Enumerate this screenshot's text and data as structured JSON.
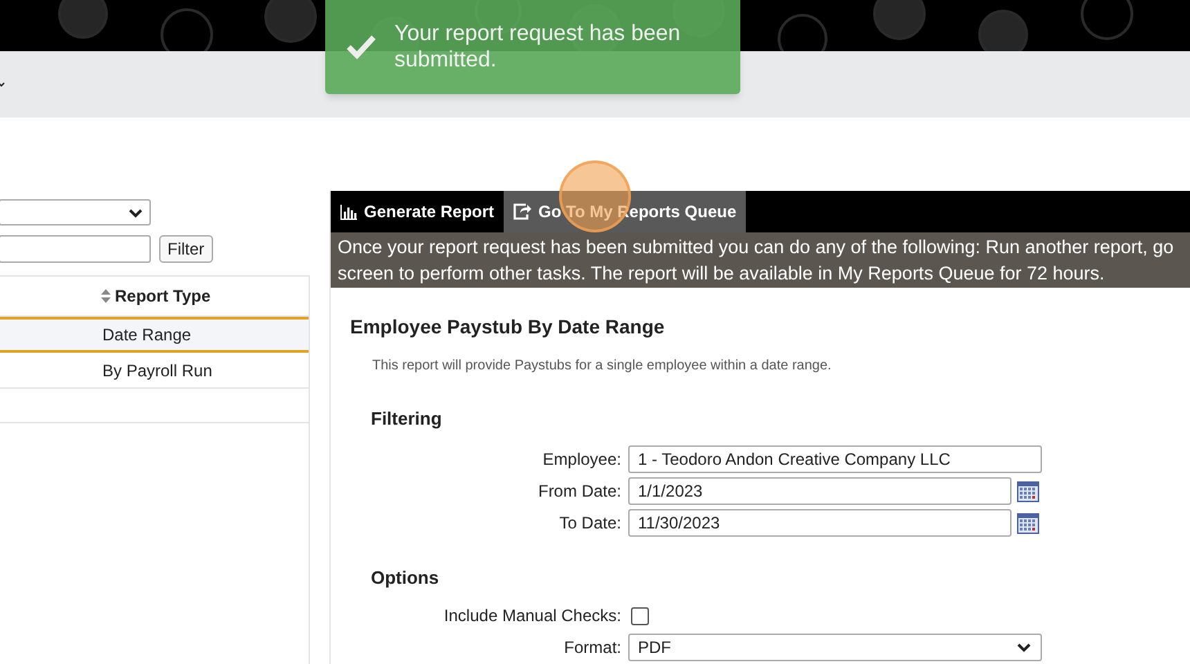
{
  "toast": {
    "message": "Your report request has been submitted."
  },
  "left_panel": {
    "filter_button": "Filter",
    "table": {
      "columns": [
        {
          "label": "Report Type"
        }
      ],
      "rows": [
        {
          "report_type": "Date Range",
          "selected": true
        },
        {
          "report_type": "By Payroll Run",
          "selected": false
        }
      ]
    }
  },
  "tabs": [
    {
      "label": "Generate Report",
      "selected": false
    },
    {
      "label": "Go To My Reports Queue",
      "selected": true
    }
  ],
  "info": "Once your report request has been submitted you can do any of the following: Run another report, go screen to perform other tasks. The report will be available in My Reports Queue for 72 hours.",
  "report": {
    "title": "Employee Paystub By Date Range",
    "description": "This report will provide Paystubs for a single employee within a date range.",
    "filtering": {
      "heading": "Filtering",
      "fields": [
        {
          "kind": "text",
          "label": "Employee:",
          "value": "1 - Teodoro Andon Creative Company LLC"
        },
        {
          "kind": "date",
          "label": "From Date:",
          "value": "1/1/2023"
        },
        {
          "kind": "date",
          "label": "To Date:",
          "value": "11/30/2023"
        }
      ]
    },
    "options": {
      "heading": "Options",
      "fields": [
        {
          "kind": "checkbox",
          "label": "Include Manual Checks:",
          "checked": false
        },
        {
          "kind": "select",
          "label": "Format:",
          "value": "PDF"
        }
      ]
    }
  }
}
